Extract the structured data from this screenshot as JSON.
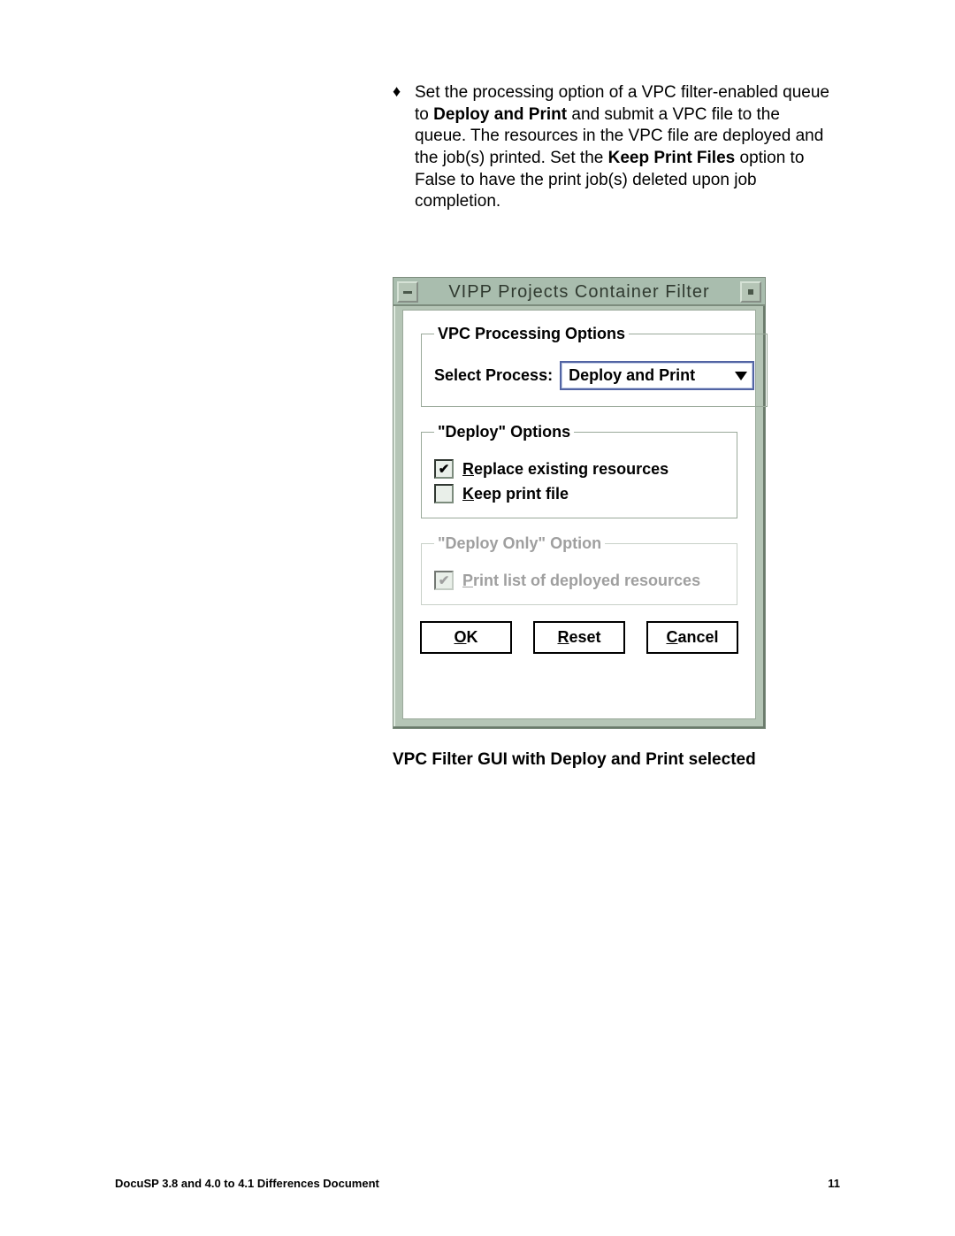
{
  "paragraph": {
    "segments": [
      "Set the processing option of a VPC filter-enabled queue to ",
      "Deploy and Print",
      " and submit a VPC file to the queue. The resources in the VPC file are deployed and the job(s) printed. Set the ",
      "Keep Print Files",
      " option to False to have the print job(s) deleted upon job completion."
    ]
  },
  "dialog": {
    "title": "VIPP Projects Container Filter",
    "group1": {
      "legend": "VPC Processing Options",
      "select_label": "Select Process:",
      "select_value": "Deploy and Print"
    },
    "group2": {
      "legend": "\"Deploy\" Options",
      "opt1_initial": "R",
      "opt1_rest": "eplace existing resources",
      "opt2_initial": "K",
      "opt2_rest": "eep print file"
    },
    "group3": {
      "legend": "\"Deploy Only\" Option",
      "opt_initial": "P",
      "opt_rest": "rint list of deployed resources"
    },
    "buttons": {
      "ok_u": "O",
      "ok_rest": "K",
      "reset_u": "R",
      "reset_rest": "eset",
      "cancel_u": "C",
      "cancel_rest": "ancel"
    }
  },
  "caption": "VPC Filter GUI with Deploy and Print selected",
  "footer_left": "DocuSP 3.8 and 4.0 to 4.1 Differences Document",
  "footer_right": "11",
  "bullet": "♦"
}
